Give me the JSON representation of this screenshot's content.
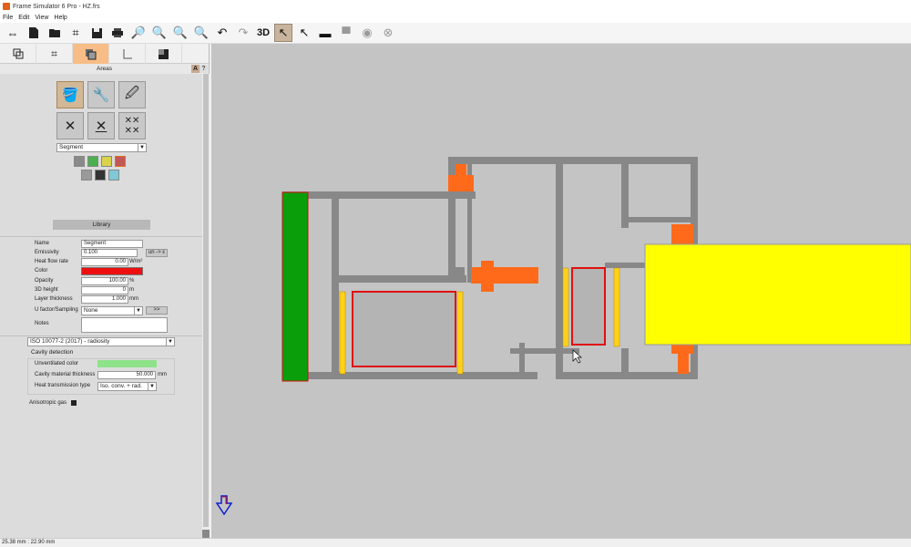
{
  "window": {
    "title": "Frame Simulator 6 Pro - HZ.frs"
  },
  "menu": [
    "File",
    "Edit",
    "View",
    "Help"
  ],
  "toolbar": {
    "three_d": "3D"
  },
  "panel": {
    "title": "Areas",
    "a_label": "A",
    "help_label": "?",
    "segment_select": "Segment",
    "library_button": "Library",
    "fields": {
      "name": {
        "label": "Name",
        "value": "Segment"
      },
      "emissivity": {
        "label": "Emissivity",
        "value": "0.100",
        "button": "un -> ε"
      },
      "heat_flow_rate": {
        "label": "Heat flow rate",
        "value": "0.00",
        "unit": "W/m²"
      },
      "color": {
        "label": "Color",
        "value": "#ee1010"
      },
      "opacity": {
        "label": "Opacity",
        "value": "100.00",
        "unit": "%"
      },
      "height_3d": {
        "label": "3D height",
        "value": "0",
        "unit": "m"
      },
      "layer_thickness": {
        "label": "Layer thickness",
        "value": "1.000",
        "unit": "mm"
      },
      "ufactor": {
        "label": "U factor/Sampling",
        "value": "None",
        "button": ">>"
      },
      "notes": {
        "label": "Notes",
        "value": ""
      }
    },
    "standard_select": "ISO 10077-2 (2017) - radiosity",
    "cavity": {
      "title": "Cavity detection",
      "unventilated_label": "Unventilated color",
      "unventilated_color": "#8ee38a",
      "thickness_label": "Cavity material thickness",
      "thickness_value": "50.000",
      "thickness_unit": "mm",
      "transmission_label": "Heat transmission type",
      "transmission_value": "Iso. conv. + rad."
    },
    "anisotropic_label": "Anisotropic gas"
  },
  "status": {
    "coords": "25.38 mm : 22.90 mm"
  },
  "colors": {
    "accent": "#f8bd86",
    "frame_gray": "#888888",
    "orange": "#ff6a1a",
    "yellow": "#ffff00",
    "green": "#0a9e0a",
    "gold": "#ffd21a",
    "red": "#ee1010"
  }
}
